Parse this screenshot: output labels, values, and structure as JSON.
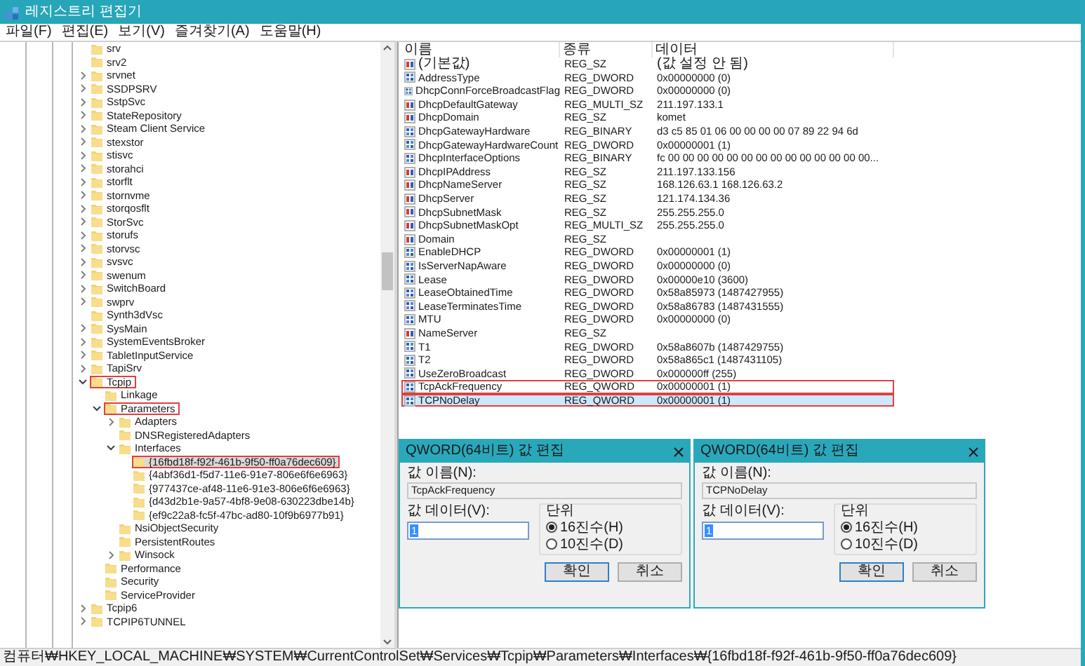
{
  "window": {
    "title": "레지스트리 편집기"
  },
  "menu": [
    "파일(F)",
    "편집(E)",
    "보기(V)",
    "즐겨찾기(A)",
    "도움말(H)"
  ],
  "tree": {
    "items": [
      {
        "label": "srv",
        "expandable": false,
        "expanded": false,
        "highlighted": false,
        "selected": false
      },
      {
        "label": "srv2",
        "expandable": false,
        "expanded": false,
        "highlighted": false,
        "selected": false
      },
      {
        "label": "srvnet",
        "expandable": true,
        "expanded": false,
        "highlighted": false,
        "selected": false
      },
      {
        "label": "SSDPSRV",
        "expandable": true,
        "expanded": false,
        "highlighted": false,
        "selected": false
      },
      {
        "label": "SstpSvc",
        "expandable": true,
        "expanded": false,
        "highlighted": false,
        "selected": false
      },
      {
        "label": "StateRepository",
        "expandable": true,
        "expanded": false,
        "highlighted": false,
        "selected": false
      },
      {
        "label": "Steam Client Service",
        "expandable": true,
        "expanded": false,
        "highlighted": false,
        "selected": false
      },
      {
        "label": "stexstor",
        "expandable": true,
        "expanded": false,
        "highlighted": false,
        "selected": false
      },
      {
        "label": "stisvc",
        "expandable": true,
        "expanded": false,
        "highlighted": false,
        "selected": false
      },
      {
        "label": "storahci",
        "expandable": true,
        "expanded": false,
        "highlighted": false,
        "selected": false
      },
      {
        "label": "storflt",
        "expandable": true,
        "expanded": false,
        "highlighted": false,
        "selected": false
      },
      {
        "label": "stornvme",
        "expandable": true,
        "expanded": false,
        "highlighted": false,
        "selected": false
      },
      {
        "label": "storqosflt",
        "expandable": true,
        "expanded": false,
        "highlighted": false,
        "selected": false
      },
      {
        "label": "StorSvc",
        "expandable": true,
        "expanded": false,
        "highlighted": false,
        "selected": false
      },
      {
        "label": "storufs",
        "expandable": true,
        "expanded": false,
        "highlighted": false,
        "selected": false
      },
      {
        "label": "storvsc",
        "expandable": true,
        "expanded": false,
        "highlighted": false,
        "selected": false
      },
      {
        "label": "svsvc",
        "expandable": true,
        "expanded": false,
        "highlighted": false,
        "selected": false
      },
      {
        "label": "swenum",
        "expandable": true,
        "expanded": false,
        "highlighted": false,
        "selected": false
      },
      {
        "label": "SwitchBoard",
        "expandable": true,
        "expanded": false,
        "highlighted": false,
        "selected": false
      },
      {
        "label": "swprv",
        "expandable": true,
        "expanded": false,
        "highlighted": false,
        "selected": false
      },
      {
        "label": "Synth3dVsc",
        "expandable": false,
        "expanded": false,
        "highlighted": false,
        "selected": false
      },
      {
        "label": "SysMain",
        "expandable": true,
        "expanded": false,
        "highlighted": false,
        "selected": false
      },
      {
        "label": "SystemEventsBroker",
        "expandable": true,
        "expanded": false,
        "highlighted": false,
        "selected": false
      },
      {
        "label": "TabletInputService",
        "expandable": true,
        "expanded": false,
        "highlighted": false,
        "selected": false
      },
      {
        "label": "TapiSrv",
        "expandable": true,
        "expanded": false,
        "highlighted": false,
        "selected": false
      },
      {
        "label": "Tcpip",
        "expandable": true,
        "expanded": true,
        "highlighted": true,
        "selected": false,
        "children": [
          {
            "label": "Linkage",
            "expandable": false,
            "expanded": false,
            "highlighted": false,
            "selected": false
          },
          {
            "label": "Parameters",
            "expandable": true,
            "expanded": true,
            "highlighted": true,
            "selected": false,
            "children": [
              {
                "label": "Adapters",
                "expandable": true,
                "expanded": false,
                "highlighted": false,
                "selected": false
              },
              {
                "label": "DNSRegisteredAdapters",
                "expandable": false,
                "expanded": false,
                "highlighted": false,
                "selected": false
              },
              {
                "label": "Interfaces",
                "expandable": true,
                "expanded": true,
                "highlighted": false,
                "selected": false,
                "children": [
                  {
                    "label": "{16fbd18f-f92f-461b-9f50-ff0a76dec609}",
                    "expandable": false,
                    "expanded": false,
                    "highlighted": true,
                    "selected": true
                  },
                  {
                    "label": "{4abf36d1-f5d7-11e6-91e7-806e6f6e6963}",
                    "expandable": false,
                    "expanded": false,
                    "highlighted": false,
                    "selected": false
                  },
                  {
                    "label": "{977437ce-af48-11e6-91e3-806e6f6e6963}",
                    "expandable": false,
                    "expanded": false,
                    "highlighted": false,
                    "selected": false
                  },
                  {
                    "label": "{d43d2b1e-9a57-4bf8-9e08-630223dbe14b}",
                    "expandable": false,
                    "expanded": false,
                    "highlighted": false,
                    "selected": false
                  },
                  {
                    "label": "{ef9c22a8-fc5f-47bc-ad80-10f9b6977b91}",
                    "expandable": false,
                    "expanded": false,
                    "highlighted": false,
                    "selected": false
                  }
                ]
              },
              {
                "label": "NsiObjectSecurity",
                "expandable": false,
                "expanded": false,
                "highlighted": false,
                "selected": false
              },
              {
                "label": "PersistentRoutes",
                "expandable": false,
                "expanded": false,
                "highlighted": false,
                "selected": false
              },
              {
                "label": "Winsock",
                "expandable": true,
                "expanded": false,
                "highlighted": false,
                "selected": false
              }
            ]
          },
          {
            "label": "Performance",
            "expandable": false,
            "expanded": false,
            "highlighted": false,
            "selected": false
          },
          {
            "label": "Security",
            "expandable": false,
            "expanded": false,
            "highlighted": false,
            "selected": false
          },
          {
            "label": "ServiceProvider",
            "expandable": false,
            "expanded": false,
            "highlighted": false,
            "selected": false
          }
        ]
      },
      {
        "label": "Tcpip6",
        "expandable": true,
        "expanded": false,
        "highlighted": false,
        "selected": false
      },
      {
        "label": "TCPIP6TUNNEL",
        "expandable": true,
        "expanded": false,
        "highlighted": false,
        "selected": false
      }
    ]
  },
  "values": {
    "columns": [
      "이름",
      "종류",
      "데이터"
    ],
    "rows": [
      {
        "name": "(기본값)",
        "type": "REG_SZ",
        "data": "(값 설정 안 됨)",
        "kind": "string",
        "highlighted": false,
        "selected": false
      },
      {
        "name": "AddressType",
        "type": "REG_DWORD",
        "data": "0x00000000 (0)",
        "kind": "binary",
        "highlighted": false,
        "selected": false
      },
      {
        "name": "DhcpConnForceBroadcastFlag",
        "type": "REG_DWORD",
        "data": "0x00000000 (0)",
        "kind": "binary",
        "highlighted": false,
        "selected": false
      },
      {
        "name": "DhcpDefaultGateway",
        "type": "REG_MULTI_SZ",
        "data": "211.197.133.1",
        "kind": "string",
        "highlighted": false,
        "selected": false
      },
      {
        "name": "DhcpDomain",
        "type": "REG_SZ",
        "data": "komet",
        "kind": "string",
        "highlighted": false,
        "selected": false
      },
      {
        "name": "DhcpGatewayHardware",
        "type": "REG_BINARY",
        "data": "d3 c5 85 01 06 00 00 00 00 07 89 22 94 6d",
        "kind": "binary",
        "highlighted": false,
        "selected": false
      },
      {
        "name": "DhcpGatewayHardwareCount",
        "type": "REG_DWORD",
        "data": "0x00000001 (1)",
        "kind": "binary",
        "highlighted": false,
        "selected": false
      },
      {
        "name": "DhcpInterfaceOptions",
        "type": "REG_BINARY",
        "data": "fc 00 00 00 00 00 00 00 00 00 00 00 00 00 00...",
        "kind": "binary",
        "highlighted": false,
        "selected": false
      },
      {
        "name": "DhcpIPAddress",
        "type": "REG_SZ",
        "data": "211.197.133.156",
        "kind": "string",
        "highlighted": false,
        "selected": false
      },
      {
        "name": "DhcpNameServer",
        "type": "REG_SZ",
        "data": "168.126.63.1 168.126.63.2",
        "kind": "string",
        "highlighted": false,
        "selected": false
      },
      {
        "name": "DhcpServer",
        "type": "REG_SZ",
        "data": "121.174.134.36",
        "kind": "string",
        "highlighted": false,
        "selected": false
      },
      {
        "name": "DhcpSubnetMask",
        "type": "REG_SZ",
        "data": "255.255.255.0",
        "kind": "string",
        "highlighted": false,
        "selected": false
      },
      {
        "name": "DhcpSubnetMaskOpt",
        "type": "REG_MULTI_SZ",
        "data": "255.255.255.0",
        "kind": "string",
        "highlighted": false,
        "selected": false
      },
      {
        "name": "Domain",
        "type": "REG_SZ",
        "kind": "string",
        "highlighted": false,
        "selected": false
      },
      {
        "name": "EnableDHCP",
        "type": "REG_DWORD",
        "data": "0x00000001 (1)",
        "kind": "binary",
        "highlighted": false,
        "selected": false
      },
      {
        "name": "IsServerNapAware",
        "type": "REG_DWORD",
        "data": "0x00000000 (0)",
        "kind": "binary",
        "highlighted": false,
        "selected": false
      },
      {
        "name": "Lease",
        "type": "REG_DWORD",
        "data": "0x00000e10 (3600)",
        "kind": "binary",
        "highlighted": false,
        "selected": false
      },
      {
        "name": "LeaseObtainedTime",
        "type": "REG_DWORD",
        "data": "0x58a85973 (1487427955)",
        "kind": "binary",
        "highlighted": false,
        "selected": false
      },
      {
        "name": "LeaseTerminatesTime",
        "type": "REG_DWORD",
        "data": "0x58a86783 (1487431555)",
        "kind": "binary",
        "highlighted": false,
        "selected": false
      },
      {
        "name": "MTU",
        "type": "REG_DWORD",
        "data": "0x00000000 (0)",
        "kind": "binary",
        "highlighted": false,
        "selected": false
      },
      {
        "name": "NameServer",
        "type": "REG_SZ",
        "kind": "string",
        "highlighted": false,
        "selected": false
      },
      {
        "name": "T1",
        "type": "REG_DWORD",
        "data": "0x58a8607b (1487429755)",
        "kind": "binary",
        "highlighted": false,
        "selected": false
      },
      {
        "name": "T2",
        "type": "REG_DWORD",
        "data": "0x58a865c1 (1487431105)",
        "kind": "binary",
        "highlighted": false,
        "selected": false
      },
      {
        "name": "UseZeroBroadcast",
        "type": "REG_DWORD",
        "data": "0x000000ff (255)",
        "kind": "binary",
        "highlighted": false,
        "selected": false
      },
      {
        "name": "TcpAckFrequency",
        "type": "REG_QWORD",
        "data": "0x00000001 (1)",
        "kind": "binary",
        "highlighted": true,
        "selected": false
      },
      {
        "name": "TCPNoDelay",
        "type": "REG_QWORD",
        "data": "0x00000001 (1)",
        "kind": "binary",
        "highlighted": true,
        "selected": true
      }
    ]
  },
  "dialogs": [
    {
      "title": "QWORD(64비트) 값 편집",
      "name_label": "값 이름(N):",
      "name_value": "TcpAckFrequency",
      "data_label": "값 데이터(V):",
      "data_value": "1",
      "base_label": "단위",
      "radios": [
        {
          "label": "16진수(H)",
          "selected": true
        },
        {
          "label": "10진수(D)",
          "selected": false
        }
      ],
      "buttons": [
        {
          "label": "확인",
          "default": true
        },
        {
          "label": "취소",
          "default": false
        }
      ]
    },
    {
      "title": "QWORD(64비트) 값 편집",
      "name_label": "값 이름(N):",
      "name_value": "TCPNoDelay",
      "data_label": "값 데이터(V):",
      "data_value": "1",
      "base_label": "단위",
      "radios": [
        {
          "label": "16진수(H)",
          "selected": true
        },
        {
          "label": "10진수(D)",
          "selected": false
        }
      ],
      "buttons": [
        {
          "label": "확인",
          "default": true
        },
        {
          "label": "취소",
          "default": false
        }
      ]
    }
  ],
  "status_bar": "컴퓨터₩HKEY_LOCAL_MACHINE₩SYSTEM₩CurrentControlSet₩Services₩Tcpip₩Parameters₩Interfaces₩{16fbd18f-f92f-461b-9f50-ff0a76dec609}"
}
